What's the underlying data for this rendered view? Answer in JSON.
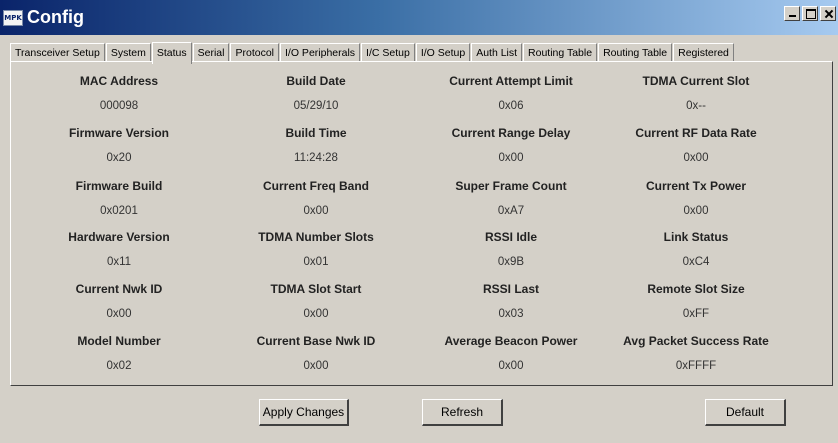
{
  "window": {
    "title": "Config",
    "icon_label": "MPK"
  },
  "tabs": [
    {
      "label": "Transceiver Setup",
      "active": false
    },
    {
      "label": "System",
      "active": false
    },
    {
      "label": "Status",
      "active": true
    },
    {
      "label": "Serial",
      "active": false
    },
    {
      "label": "Protocol",
      "active": false
    },
    {
      "label": "I/O Peripherals",
      "active": false
    },
    {
      "label": "I/C Setup",
      "active": false
    },
    {
      "label": "I/O Setup",
      "active": false
    },
    {
      "label": "Auth List",
      "active": false
    },
    {
      "label": "Routing Table",
      "active": false
    },
    {
      "label": "Routing Table",
      "active": false
    },
    {
      "label": "Registered",
      "active": false
    }
  ],
  "status": {
    "col1": [
      {
        "label": "MAC Address",
        "value": "000098"
      },
      {
        "label": "Firmware Version",
        "value": "0x20"
      },
      {
        "label": "Firmware Build",
        "value": "0x0201"
      },
      {
        "label": "Hardware Version",
        "value": "0x11"
      },
      {
        "label": "Current Nwk ID",
        "value": "0x00"
      },
      {
        "label": "Model Number",
        "value": "0x02"
      }
    ],
    "col2": [
      {
        "label": "Build Date",
        "value": "05/29/10"
      },
      {
        "label": "Build Time",
        "value": "11:24:28"
      },
      {
        "label": "Current Freq Band",
        "value": "0x00"
      },
      {
        "label": "TDMA Number Slots",
        "value": "0x01"
      },
      {
        "label": "TDMA Slot Start",
        "value": "0x00"
      },
      {
        "label": "Current Base Nwk ID",
        "value": "0x00"
      }
    ],
    "col3": [
      {
        "label": "Current Attempt Limit",
        "value": "0x06"
      },
      {
        "label": "Current Range Delay",
        "value": "0x00"
      },
      {
        "label": "Super Frame Count",
        "value": "0xA7"
      },
      {
        "label": "RSSI Idle",
        "value": "0x9B"
      },
      {
        "label": "RSSI Last",
        "value": "0x03"
      },
      {
        "label": "Average Beacon Power",
        "value": "0x00"
      }
    ],
    "col4": [
      {
        "label": "TDMA Current Slot",
        "value": "0x--"
      },
      {
        "label": "Current RF Data Rate",
        "value": "0x00"
      },
      {
        "label": "Current Tx Power",
        "value": "0x00"
      },
      {
        "label": "Link Status",
        "value": "0xC4"
      },
      {
        "label": "Remote Slot Size",
        "value": "0xFF"
      },
      {
        "label": "Avg Packet Success Rate",
        "value": "0xFFFF"
      }
    ]
  },
  "buttons": {
    "apply": "Apply Changes",
    "refresh": "Refresh",
    "default": "Default"
  }
}
